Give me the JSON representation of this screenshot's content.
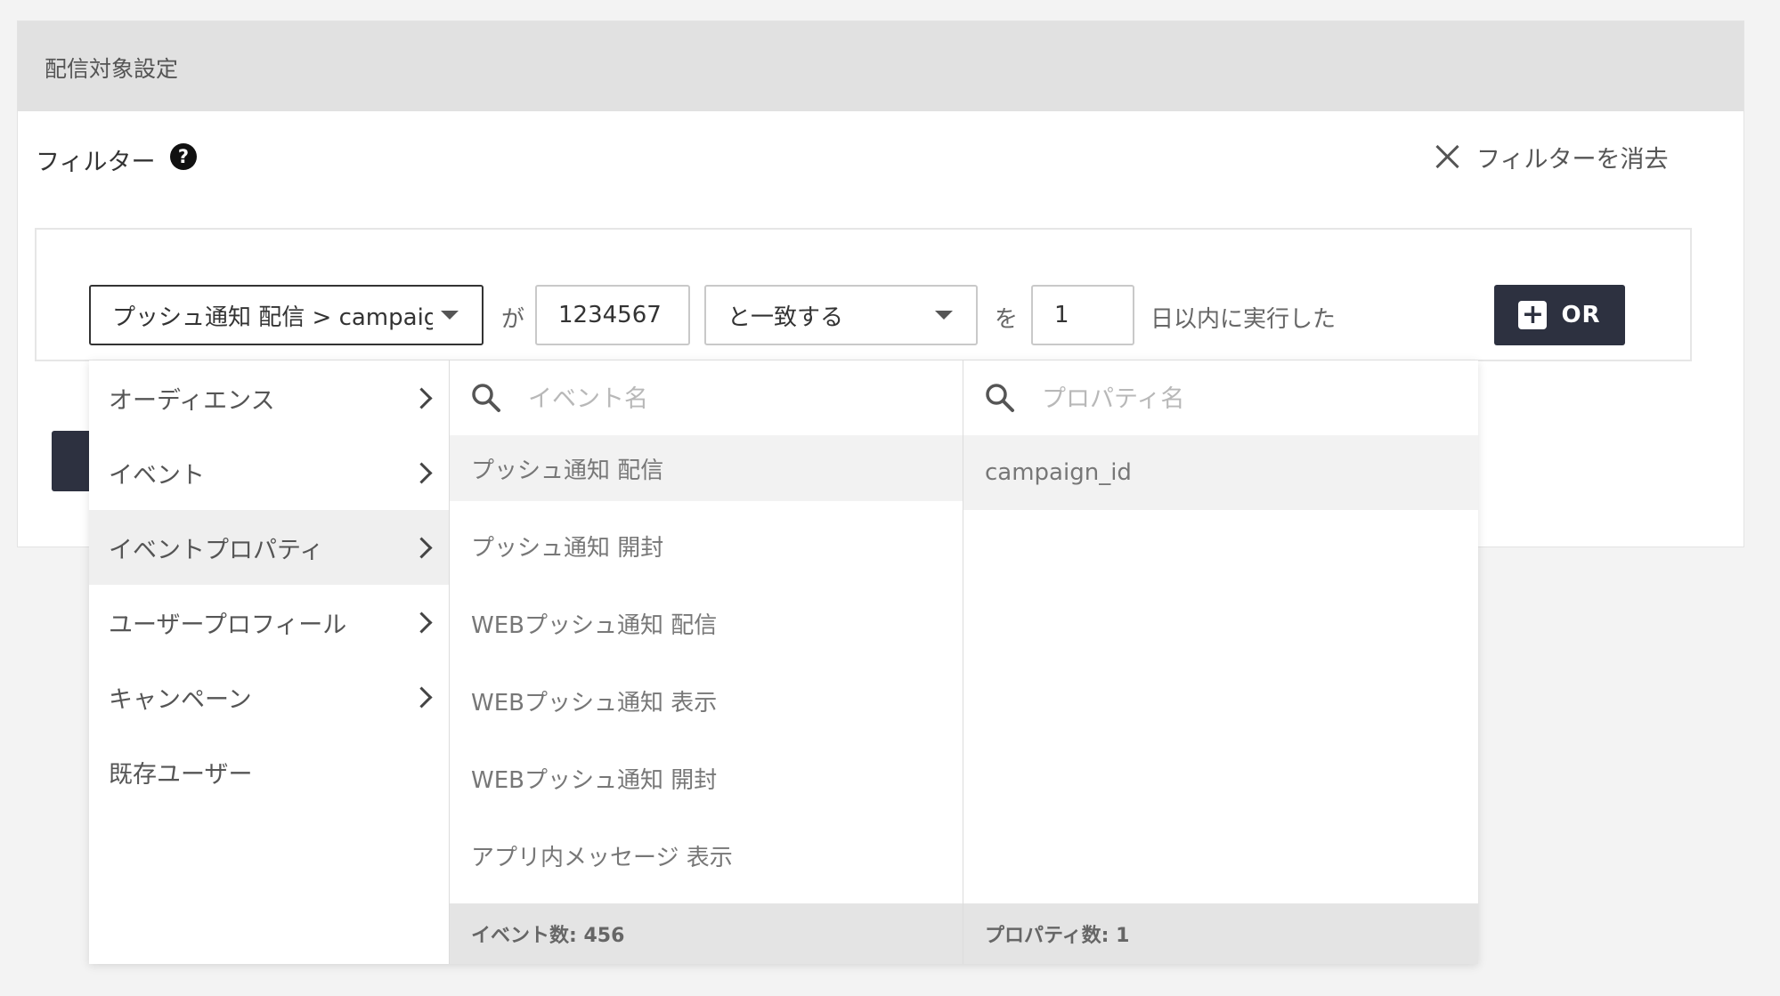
{
  "panel": {
    "title": "配信対象設定",
    "filter_label": "フィルター",
    "help_symbol": "?",
    "clear_label": "フィルターを消去"
  },
  "filter": {
    "event_select_value": "プッシュ通知 配信 > campaign_id",
    "connector_ga": "が",
    "value_input": "1234567",
    "match_select_value": "と一致する",
    "connector_wo": "を",
    "days_input": "1",
    "days_suffix": "日以内に実行した",
    "or_button_label": "OR",
    "or_button_symbol": "+"
  },
  "dropdown": {
    "categories": [
      {
        "label": "オーディエンス",
        "has_submenu": true,
        "active": false
      },
      {
        "label": "イベント",
        "has_submenu": true,
        "active": false
      },
      {
        "label": "イベントプロパティ",
        "has_submenu": true,
        "active": true
      },
      {
        "label": "ユーザープロフィール",
        "has_submenu": true,
        "active": false
      },
      {
        "label": "キャンペーン",
        "has_submenu": true,
        "active": false
      },
      {
        "label": "既存ユーザー",
        "has_submenu": false,
        "active": false
      }
    ],
    "events": {
      "search_placeholder": "イベント名",
      "items": [
        {
          "label": "プッシュ通知 配信",
          "active": true
        },
        {
          "label": "プッシュ通知 開封",
          "active": false
        },
        {
          "label": "WEBプッシュ通知 配信",
          "active": false
        },
        {
          "label": "WEBプッシュ通知 表示",
          "active": false
        },
        {
          "label": "WEBプッシュ通知 開封",
          "active": false
        },
        {
          "label": "アプリ内メッセージ 表示",
          "active": false
        }
      ],
      "count_label": "イベント数: 456"
    },
    "properties": {
      "search_placeholder": "プロパティ名",
      "items": [
        {
          "label": "campaign_id",
          "active": true
        }
      ],
      "count_label": "プロパティ数: 1"
    }
  },
  "colors": {
    "dark_button": "#2d3140",
    "header_bg": "#e1e1e1",
    "active_row": "#efefef"
  }
}
